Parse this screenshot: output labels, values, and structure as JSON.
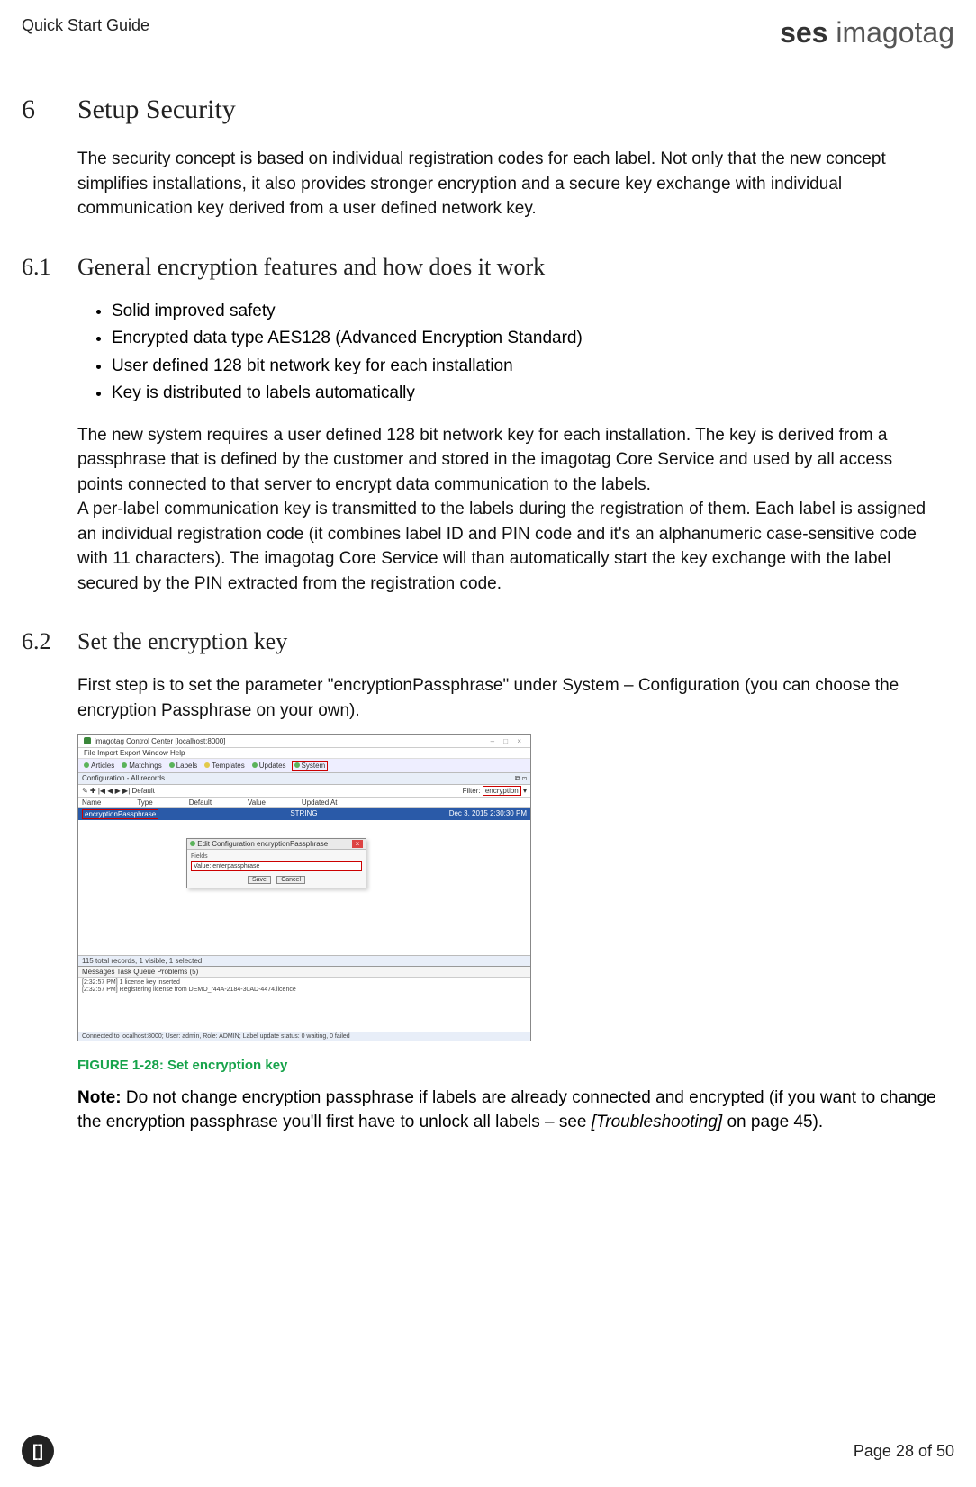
{
  "header": {
    "guide": "Quick Start Guide",
    "brandBold": "ses",
    "brandLight": " imagotag"
  },
  "s6": {
    "num": "6",
    "title": "Setup Security",
    "intro": "The security concept is based on individual registration codes for each label. Not only that the new concept simplifies installations, it also provides stronger encryption and a secure key exchange with individual communication key derived from a user defined network key."
  },
  "s61": {
    "num": "6.1",
    "title": "General encryption features and how does it work",
    "bullets": [
      "Solid improved safety",
      "Encrypted data type AES128 (Advanced Encryption Standard)",
      "User defined 128 bit network key for each installation",
      "Key is distributed to labels automatically"
    ],
    "p1": "The new system requires a user defined 128 bit network key for each installation. The key is derived from a passphrase that is defined by the customer and stored in the imagotag Core Service and used by all access points connected to that server to encrypt data communication to the labels.",
    "p2": "A per-label communication key is transmitted to the labels during the registration of them. Each label is assigned an individual registration code (it combines label ID and PIN code and it's an alphanumeric case-sensitive code with 11 characters). The imagotag Core Service will than automatically start the key exchange with the label secured by the PIN extracted from the registration code."
  },
  "s62": {
    "num": "6.2",
    "title": "Set the encryption key",
    "p1": "First step is to set the parameter \"encryptionPassphrase\" under System – Configuration (you can choose the encryption Passphrase on your own)."
  },
  "shot": {
    "winTitle": "imagotag Control Center [localhost:8000]",
    "menus": "File  Import  Export  Window  Help",
    "tabs": {
      "articles": "Articles",
      "matchings": "Matchings",
      "labels": "Labels",
      "templates": "Templates",
      "updates": "Updates",
      "system": "System"
    },
    "subhead": "Configuration - All records",
    "toolbarLeft": "Default",
    "filterLabel": "Filter:",
    "filterValue": "encryption",
    "cols": {
      "name": "Name",
      "type": "Type",
      "default": "Default",
      "value": "Value",
      "updated": "Updated At"
    },
    "row": {
      "name": "encryptionPassphrase",
      "type": "STRING",
      "updated": "Dec 3, 2015 2:30:30 PM"
    },
    "dialog": {
      "title": "Edit Configuration encryptionPassphrase",
      "fields": "Fields",
      "valueLbl": "Value:",
      "value": "enterpassphrase",
      "save": "Save",
      "cancel": "Cancel"
    },
    "status1": "115 total records, 1 visible, 1 selected",
    "msgTabs": "Messages   Task Queue   Problems (5)",
    "msg1": "[2:32:57 PM] 1 license key inserted",
    "msg2": "[2:32:57 PM] Registering license from DEMO_r44A-2184-30AD-4474.licence",
    "footStatus": "Connected to localhost:8000; User: admin, Role: ADMIN; Label update status: 0 waiting, 0 failed"
  },
  "figCaption": "FIGURE 1-28: Set encryption key",
  "note": {
    "bold": "Note:",
    "text1": " Do not change encryption passphrase if labels are already connected and encrypted (if you want to change the encryption passphrase you'll first have to unlock all labels – see ",
    "ital": "[Troubleshooting]",
    "text2": " on page 45)."
  },
  "footer": {
    "badge": "[]",
    "page": "Page 28 of 50"
  }
}
